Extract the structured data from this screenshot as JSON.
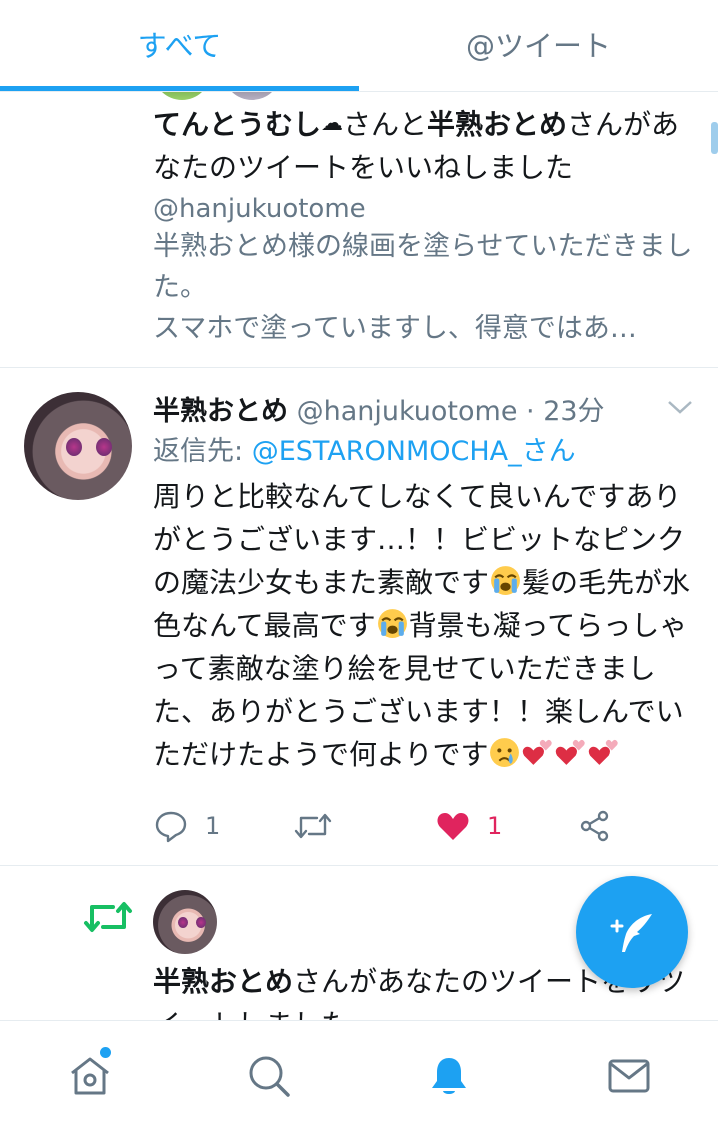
{
  "tabs": {
    "all_label": "すべて",
    "mentions_label": "@ツイート"
  },
  "notification_like": {
    "user1": "てんとうむし",
    "user1_suffix_emoji": "☁",
    "joiner": "さんと",
    "user2": "半熟おとめ",
    "action": "さんがあなたのツイートをいいねしました",
    "quoted_handle": "@hanjukuotome",
    "quoted_line1": "半熟おとめ様の線画を塗らせていただきました。",
    "quoted_line2": "スマホで塗っていますし、得意ではあ…"
  },
  "tweet": {
    "display_name": "半熟おとめ",
    "handle": "@hanjukuotome",
    "time": "· 23分",
    "reply_prefix": "返信先: ",
    "reply_to": "@ESTARONMOCHA_さん",
    "text_1": "周りと比較なんてしなくて良いんですありがとうございます…！！ビビットなピンクの魔法少女もまた素敵です",
    "text_2": "髪の毛先が水色なんて最高です",
    "text_3": "背景も凝ってらっしゃって素敵な塗り絵を見せていただきました、ありがとうございます！！楽しんでいただけたようで何よりです",
    "reply_count": "1",
    "like_count": "1"
  },
  "notification_retweet": {
    "user": "半熟おとめ",
    "action": "さんがあなたのツイートをリツイートしました"
  },
  "nav": {
    "items": [
      "home-icon",
      "search-icon",
      "notifications-icon",
      "messages-icon"
    ],
    "active": "notifications-icon"
  },
  "colors": {
    "accent": "#1da1f2",
    "like": "#e0245e",
    "retweet": "#17bf63",
    "secondary_text": "#657786"
  }
}
